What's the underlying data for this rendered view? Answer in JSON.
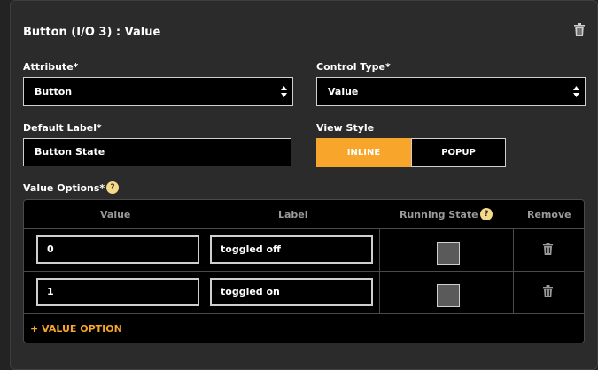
{
  "panel": {
    "title": "Button (I/O 3) : Value"
  },
  "form": {
    "attribute": {
      "label": "Attribute*",
      "value": "Button"
    },
    "control_type": {
      "label": "Control Type*",
      "value": "Value"
    },
    "default_label": {
      "label": "Default Label*",
      "value": "Button State"
    },
    "view_style": {
      "label": "View Style",
      "options": [
        "INLINE",
        "POPUP"
      ],
      "selected": "INLINE"
    }
  },
  "value_options": {
    "label": "Value Options*",
    "help": "?",
    "columns": {
      "value": "Value",
      "label": "Label",
      "running_state": "Running State",
      "remove": "Remove"
    },
    "rows": [
      {
        "value": "0",
        "label": "toggled off"
      },
      {
        "value": "1",
        "label": "toggled on"
      }
    ],
    "add_label": "+ VALUE OPTION"
  },
  "colors": {
    "accent": "#f7a52b",
    "background": "#2b2b2b",
    "field": "#000000"
  },
  "icons": {
    "delete": "trash-icon",
    "select": "updown-chevron-icon",
    "help": "help-icon"
  }
}
